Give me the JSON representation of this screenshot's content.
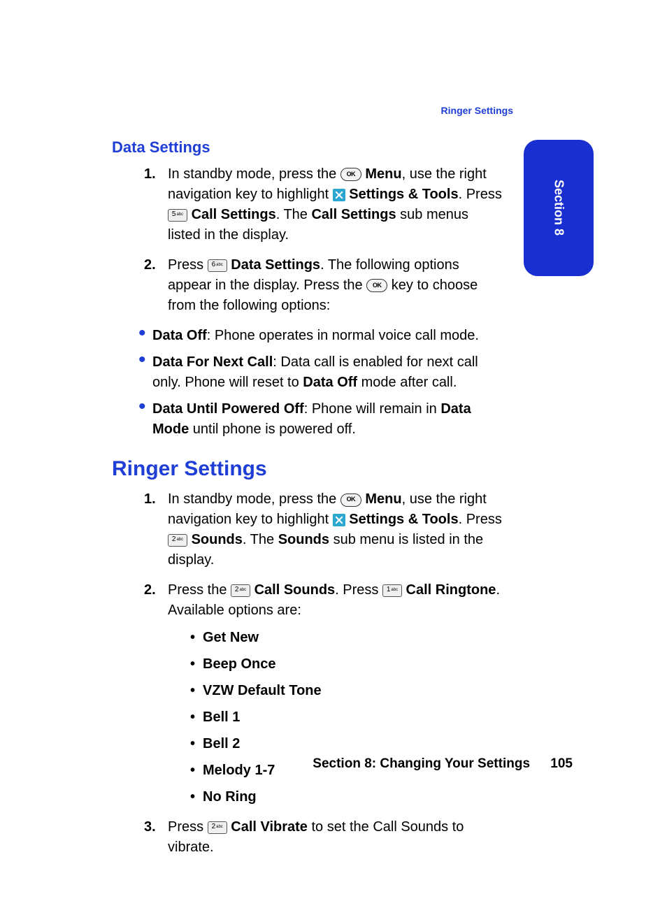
{
  "running_head": "Ringer Settings",
  "side_tab": "Section 8",
  "subhead": "Data Settings",
  "steps_a": [
    {
      "num": "1.",
      "parts": [
        {
          "t": "In standby mode, press the "
        },
        {
          "icon": "ok"
        },
        {
          "t": " "
        },
        {
          "b": "Menu"
        },
        {
          "t": ", use the right navigation key to highlight "
        },
        {
          "icon": "tools"
        },
        {
          "t": " "
        },
        {
          "b": "Settings & Tools"
        },
        {
          "t": ". Press "
        },
        {
          "key": "5"
        },
        {
          "t": " "
        },
        {
          "b": "Call Settings"
        },
        {
          "t": ". The "
        },
        {
          "b": "Call Settings"
        },
        {
          "t": " sub menus listed in the display."
        }
      ]
    },
    {
      "num": "2.",
      "parts": [
        {
          "t": "Press "
        },
        {
          "key": "6"
        },
        {
          "t": " "
        },
        {
          "b": "Data Settings"
        },
        {
          "t": ". The following options appear in the display. Press the "
        },
        {
          "icon": "ok"
        },
        {
          "t": " key to choose from the following options:"
        }
      ]
    }
  ],
  "bullets_a": [
    [
      {
        "b": "Data Off"
      },
      {
        "t": ": Phone operates in normal voice call mode."
      }
    ],
    [
      {
        "b": "Data For Next Call"
      },
      {
        "t": ": Data call is enabled for next call only. Phone will reset to "
      },
      {
        "b": "Data Off"
      },
      {
        "t": " mode after call."
      }
    ],
    [
      {
        "b": "Data Until Powered Off"
      },
      {
        "t": ": Phone will remain in "
      },
      {
        "b": "Data Mode"
      },
      {
        "t": " until phone is powered off."
      }
    ]
  ],
  "section_title": "Ringer Settings",
  "steps_b": [
    {
      "num": "1.",
      "parts": [
        {
          "t": "In standby mode, press the "
        },
        {
          "icon": "ok"
        },
        {
          "t": " "
        },
        {
          "b": "Menu"
        },
        {
          "t": ", use the right navigation key to highlight "
        },
        {
          "icon": "tools"
        },
        {
          "t": " "
        },
        {
          "b": "Settings & Tools"
        },
        {
          "t": ". Press "
        },
        {
          "key": "2"
        },
        {
          "t": " "
        },
        {
          "b": "Sounds"
        },
        {
          "t": ". The "
        },
        {
          "b": "Sounds"
        },
        {
          "t": " sub menu is listed in the display."
        }
      ]
    },
    {
      "num": "2.",
      "parts": [
        {
          "t": "Press the "
        },
        {
          "key": "2"
        },
        {
          "t": " "
        },
        {
          "b": "Call Sounds"
        },
        {
          "t": ". Press "
        },
        {
          "key": "1"
        },
        {
          "t": " "
        },
        {
          "b": "Call Ringtone"
        },
        {
          "t": ". Available options are:"
        }
      ],
      "sub": [
        "Get New",
        "Beep Once",
        "VZW Default Tone",
        "Bell 1",
        "Bell 2",
        "Melody 1-7",
        "No Ring"
      ]
    },
    {
      "num": "3.",
      "parts": [
        {
          "t": "Press "
        },
        {
          "key": "2"
        },
        {
          "t": " "
        },
        {
          "b": "Call Vibrate"
        },
        {
          "t": " to set the Call Sounds to vibrate."
        }
      ]
    }
  ],
  "footer_label": "Section 8: Changing Your Settings",
  "footer_page": "105"
}
